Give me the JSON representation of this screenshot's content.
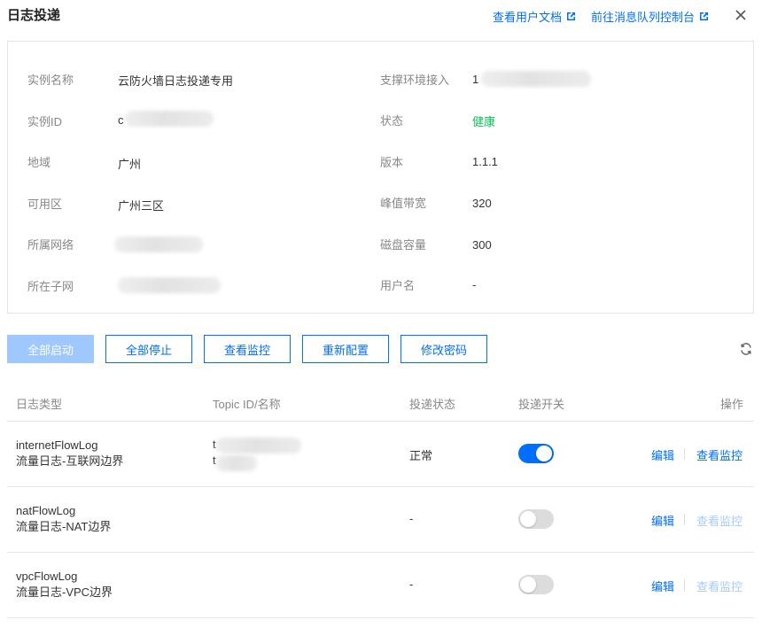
{
  "header": {
    "title": "日志投递",
    "doc_link": "查看用户文档",
    "console_link": "前往消息队列控制台"
  },
  "info": {
    "left": [
      {
        "label": "实例名称",
        "value": "云防火墙日志投递专用"
      },
      {
        "label": "实例ID",
        "value": "c"
      },
      {
        "label": "地域",
        "value": "广州"
      },
      {
        "label": "可用区",
        "value": "广州三区"
      },
      {
        "label": "所属网络",
        "value": ""
      },
      {
        "label": "所在子网",
        "value": ""
      }
    ],
    "right": [
      {
        "label": "支撑环境接入",
        "value": "1"
      },
      {
        "label": "状态",
        "value": "健康"
      },
      {
        "label": "版本",
        "value": "1.1.1"
      },
      {
        "label": "峰值带宽",
        "value": "320"
      },
      {
        "label": "磁盘容量",
        "value": "300"
      },
      {
        "label": "用户名",
        "value": "-"
      }
    ]
  },
  "toolbar": {
    "start_all": "全部启动",
    "stop_all": "全部停止",
    "view_monitor": "查看监控",
    "reconfigure": "重新配置",
    "change_password": "修改密码"
  },
  "table": {
    "headers": [
      "日志类型",
      "Topic ID/名称",
      "投递状态",
      "投递开关",
      "操作"
    ],
    "rows": [
      {
        "type": "internetFlowLog",
        "desc": "流量日志-互联网边界",
        "topic": "t",
        "topic2": "t",
        "status": "正常",
        "enabled": true,
        "edit": "编辑",
        "monitor": "查看监控"
      },
      {
        "type": "natFlowLog",
        "desc": "流量日志-NAT边界",
        "topic": "",
        "topic2": "",
        "status": "-",
        "enabled": false,
        "edit": "编辑",
        "monitor": "查看监控"
      },
      {
        "type": "vpcFlowLog",
        "desc": "流量日志-VPC边界",
        "topic": "",
        "topic2": "",
        "status": "-",
        "enabled": false,
        "edit": "编辑",
        "monitor": "查看监控"
      }
    ]
  },
  "colors": {
    "accent": "#006eff",
    "healthy": "#0abf5b",
    "disabled_primary": "#9fc8ff"
  }
}
